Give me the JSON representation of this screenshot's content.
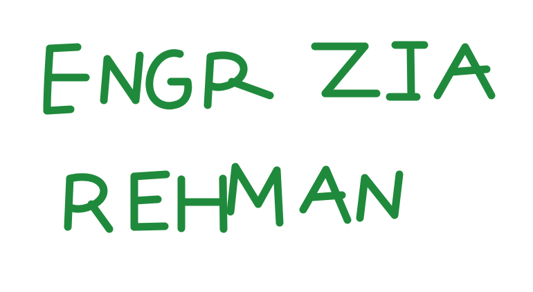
{
  "handwriting": {
    "line1": "ENGR ZIA",
    "line2": "REHMAN",
    "ink_color": "#1f8a3c",
    "background": "#ffffff"
  }
}
